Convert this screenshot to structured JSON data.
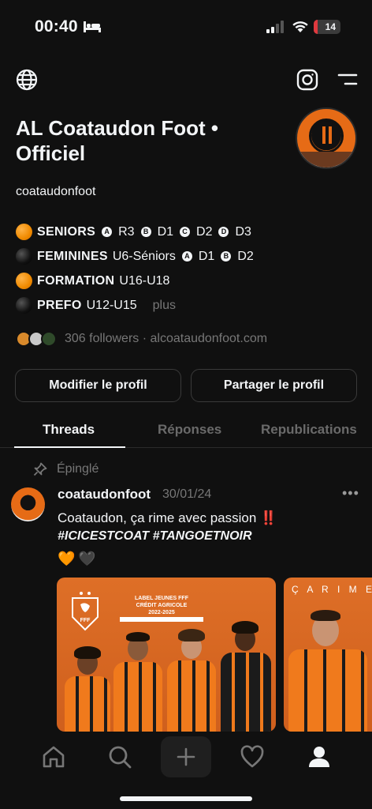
{
  "status": {
    "time": "00:40",
    "battery": "14",
    "battery_level": 0.14
  },
  "profile": {
    "name": "AL Coataudon Foot • Officiel",
    "handle": "coataudonfoot",
    "bio": {
      "l1_title": "SENIORS",
      "l1_a": "A",
      "l1_a_val": "R3",
      "l1_b": "B",
      "l1_b_val": "D1",
      "l1_c": "C",
      "l1_c_val": "D2",
      "l1_d": "D",
      "l1_d_val": "D3",
      "l2_title": "FEMININES",
      "l2_range": "U6-Séniors",
      "l2_a": "A",
      "l2_a_val": "D1",
      "l2_b": "B",
      "l2_b_val": "D2",
      "l3_title": "FORMATION",
      "l3_range": "U16-U18",
      "l4_title": "PREFO",
      "l4_range": "U12-U15",
      "more": "plus"
    },
    "followers_text": "306 followers · alcoataudonfoot.com",
    "edit_button": "Modifier le profil",
    "share_button": "Partager le profil"
  },
  "tabs": [
    "Threads",
    "Réponses",
    "Republications"
  ],
  "post": {
    "pinned": "Épinglé",
    "user": "coataudonfoot",
    "date": "30/01/24",
    "more": "•••",
    "text": "Coataudon, ça rime avec passion",
    "exclaim": "‼️",
    "tags": "#ICICESTCOAT #TANGOETNOIR",
    "hearts": [
      "🧡",
      "🖤"
    ],
    "image1": {
      "label_line1": "LABEL JEUNES FFF",
      "label_line2": "CRÉDIT AGRICOLE",
      "label_line3": "2022-2025",
      "fff": "FFF"
    },
    "image2": {
      "caption": "Ç A  R I M E  A V"
    }
  },
  "colors": {
    "accent_orange": "#e66b16",
    "background": "#101010",
    "muted": "#777777",
    "alert": "#e2332f"
  },
  "icons": [
    "globe-icon",
    "instagram-icon",
    "menu-icon",
    "pin-icon",
    "home-icon",
    "search-icon",
    "plus-icon",
    "heart-icon",
    "profile-icon"
  ]
}
